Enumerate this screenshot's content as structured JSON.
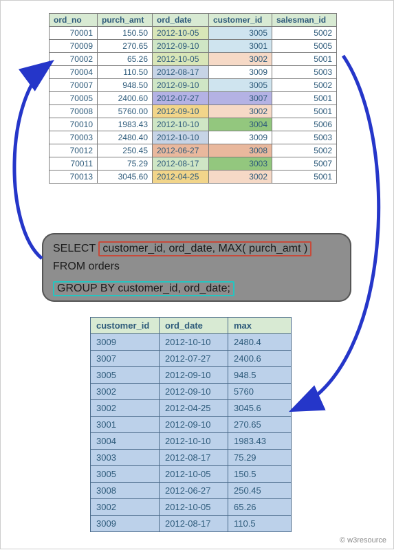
{
  "top_table": {
    "headers": [
      "ord_no",
      "purch_amt",
      "ord_date",
      "customer_id",
      "salesman_id"
    ],
    "rows": [
      {
        "ord_no": "70001",
        "purch_amt": "150.50",
        "ord_date": "2012-10-05",
        "customer_id": "3005",
        "salesman_id": "5002",
        "date_color": "#d9e6b8",
        "cust_color": "#cfe4ef"
      },
      {
        "ord_no": "70009",
        "purch_amt": "270.65",
        "ord_date": "2012-09-10",
        "customer_id": "3001",
        "salesman_id": "5005",
        "date_color": "#cfe6c5",
        "cust_color": "#cfe4ef"
      },
      {
        "ord_no": "70002",
        "purch_amt": "65.26",
        "ord_date": "2012-10-05",
        "customer_id": "3002",
        "salesman_id": "5001",
        "date_color": "#d9e6b8",
        "cust_color": "#f6d9c6"
      },
      {
        "ord_no": "70004",
        "purch_amt": "110.50",
        "ord_date": "2012-08-17",
        "customer_id": "3009",
        "salesman_id": "5003",
        "date_color": "#c7d4e6",
        "cust_color": "#ffffff"
      },
      {
        "ord_no": "70007",
        "purch_amt": "948.50",
        "ord_date": "2012-09-10",
        "customer_id": "3005",
        "salesman_id": "5002",
        "date_color": "#cfe6c5",
        "cust_color": "#cfe4ef"
      },
      {
        "ord_no": "70005",
        "purch_amt": "2400.60",
        "ord_date": "2012-07-27",
        "customer_id": "3007",
        "salesman_id": "5001",
        "date_color": "#b4b2e4",
        "cust_color": "#b4b2e4"
      },
      {
        "ord_no": "70008",
        "purch_amt": "5760.00",
        "ord_date": "2012-09-10",
        "customer_id": "3002",
        "salesman_id": "5001",
        "date_color": "#f2d58a",
        "cust_color": "#f6d9c6"
      },
      {
        "ord_no": "70010",
        "purch_amt": "1983.43",
        "ord_date": "2012-10-10",
        "customer_id": "3004",
        "salesman_id": "5006",
        "date_color": "#cfe6c5",
        "cust_color": "#93c77e"
      },
      {
        "ord_no": "70003",
        "purch_amt": "2480.40",
        "ord_date": "2012-10-10",
        "customer_id": "3009",
        "salesman_id": "5003",
        "date_color": "#c7d4e6",
        "cust_color": "#ffffff"
      },
      {
        "ord_no": "70012",
        "purch_amt": "250.45",
        "ord_date": "2012-06-27",
        "customer_id": "3008",
        "salesman_id": "5002",
        "date_color": "#e9b89d",
        "cust_color": "#e9b89d"
      },
      {
        "ord_no": "70011",
        "purch_amt": "75.29",
        "ord_date": "2012-08-17",
        "customer_id": "3003",
        "salesman_id": "5007",
        "date_color": "#cfe6c5",
        "cust_color": "#93c77e"
      },
      {
        "ord_no": "70013",
        "purch_amt": "3045.60",
        "ord_date": "2012-04-25",
        "customer_id": "3002",
        "salesman_id": "5001",
        "date_color": "#f2d58a",
        "cust_color": "#f6d9c6"
      }
    ]
  },
  "sql": {
    "select_kw": "SELECT",
    "select_cols": "customer_id, ord_date, MAX( purch_amt )",
    "from": "FROM orders",
    "groupby": "GROUP BY customer_id, ord_date;"
  },
  "bottom_table": {
    "headers": [
      "customer_id",
      "ord_date",
      "max"
    ],
    "rows": [
      {
        "customer_id": "3009",
        "ord_date": "2012-10-10",
        "max": "2480.4"
      },
      {
        "customer_id": "3007",
        "ord_date": "2012-07-27",
        "max": "2400.6"
      },
      {
        "customer_id": "3005",
        "ord_date": "2012-09-10",
        "max": "948.5"
      },
      {
        "customer_id": "3002",
        "ord_date": "2012-09-10",
        "max": "5760"
      },
      {
        "customer_id": "3002",
        "ord_date": "2012-04-25",
        "max": "3045.6"
      },
      {
        "customer_id": "3001",
        "ord_date": "2012-09-10",
        "max": "270.65"
      },
      {
        "customer_id": "3004",
        "ord_date": "2012-10-10",
        "max": "1983.43"
      },
      {
        "customer_id": "3003",
        "ord_date": "2012-08-17",
        "max": "75.29"
      },
      {
        "customer_id": "3005",
        "ord_date": "2012-10-05",
        "max": "150.5"
      },
      {
        "customer_id": "3008",
        "ord_date": "2012-06-27",
        "max": "250.45"
      },
      {
        "customer_id": "3002",
        "ord_date": "2012-10-05",
        "max": "65.26"
      },
      {
        "customer_id": "3009",
        "ord_date": "2012-08-17",
        "max": "110.5"
      }
    ]
  },
  "footer": "© w3resource"
}
